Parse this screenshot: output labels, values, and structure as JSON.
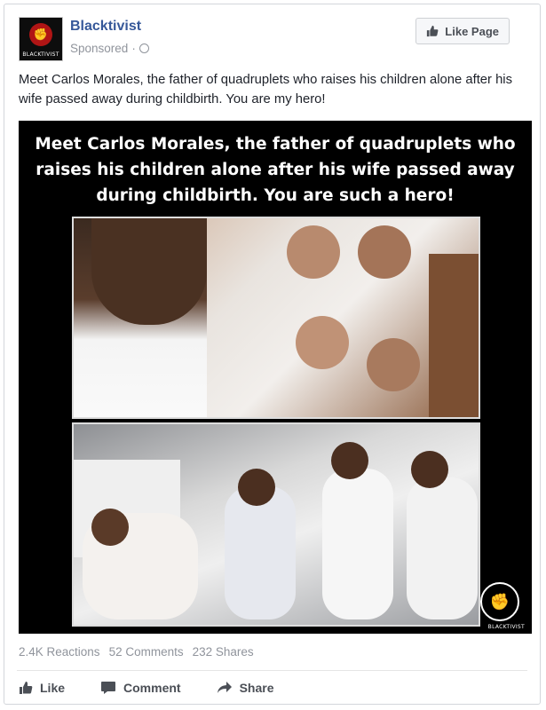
{
  "post": {
    "page_name": "Blacktivist",
    "sponsored_label": "Sponsored",
    "dot": "·",
    "avatar_text": "BLACKTIVIST",
    "like_page_label": "Like Page",
    "text": "Meet Carlos Morales, the father of quadruplets who raises his children alone after his wife passed away during childbirth. You are my hero!"
  },
  "media": {
    "caption": "Meet Carlos Morales, the father of quadruplets who raises his children alone after his wife passed away during childbirth. You are such a hero!",
    "watermark_text": "BLACKTIVIST"
  },
  "stats": {
    "reactions": "2.4K Reactions",
    "comments": "52 Comments",
    "shares": "232 Shares"
  },
  "actions": {
    "like": "Like",
    "comment": "Comment",
    "share": "Share"
  },
  "colors": {
    "link": "#365899",
    "muted": "#90949c",
    "avatar_red": "#b01515"
  },
  "icons": [
    "globe-icon",
    "thumbs-up-icon",
    "comment-icon",
    "share-icon",
    "fist-icon"
  ]
}
